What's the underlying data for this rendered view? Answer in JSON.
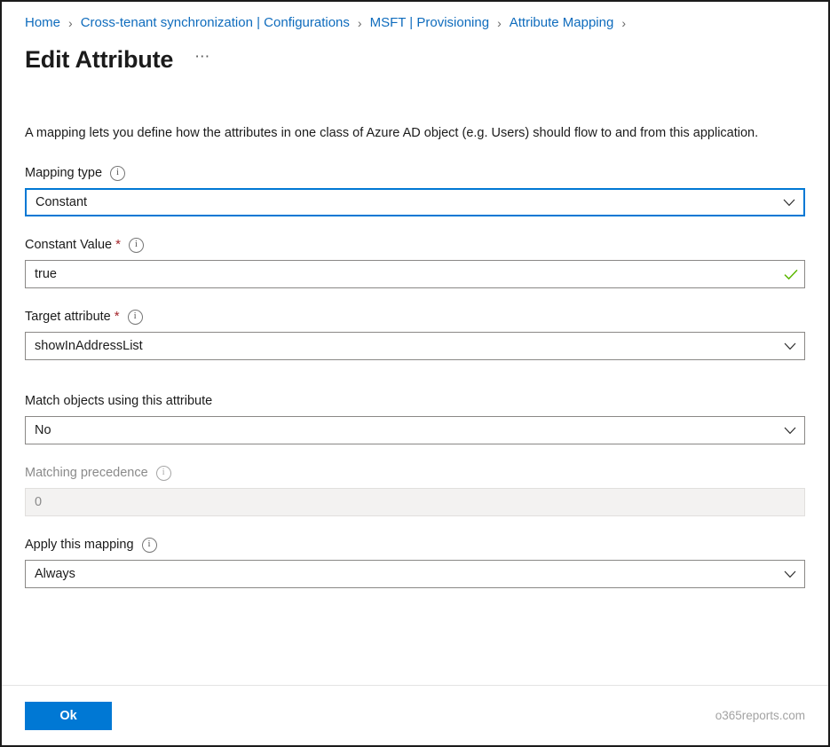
{
  "breadcrumb": {
    "items": [
      {
        "label": "Home"
      },
      {
        "label": "Cross-tenant synchronization | Configurations"
      },
      {
        "label": "MSFT | Provisioning"
      },
      {
        "label": "Attribute Mapping"
      }
    ],
    "separator": "›"
  },
  "header": {
    "title": "Edit Attribute",
    "more_label": "⋯"
  },
  "main": {
    "description": "A mapping lets you define how the attributes in one class of Azure AD object (e.g. Users) should flow to and from this application.",
    "fields": {
      "mapping_type": {
        "label": "Mapping type",
        "value": "Constant",
        "info": "i"
      },
      "constant_value": {
        "label": "Constant Value",
        "required_mark": "*",
        "value": "true",
        "info": "i"
      },
      "target_attribute": {
        "label": "Target attribute",
        "required_mark": "*",
        "value": "showInAddressList",
        "info": "i"
      },
      "match_objects": {
        "label": "Match objects using this attribute",
        "value": "No"
      },
      "matching_precedence": {
        "label": "Matching precedence",
        "value": "0",
        "info": "i"
      },
      "apply_mapping": {
        "label": "Apply this mapping",
        "value": "Always",
        "info": "i"
      }
    }
  },
  "footer": {
    "ok_label": "Ok",
    "watermark": "o365reports.com"
  },
  "colors": {
    "accent": "#0078d4",
    "link": "#0f6cbd",
    "required": "#a4262c",
    "success": "#5bb700"
  }
}
